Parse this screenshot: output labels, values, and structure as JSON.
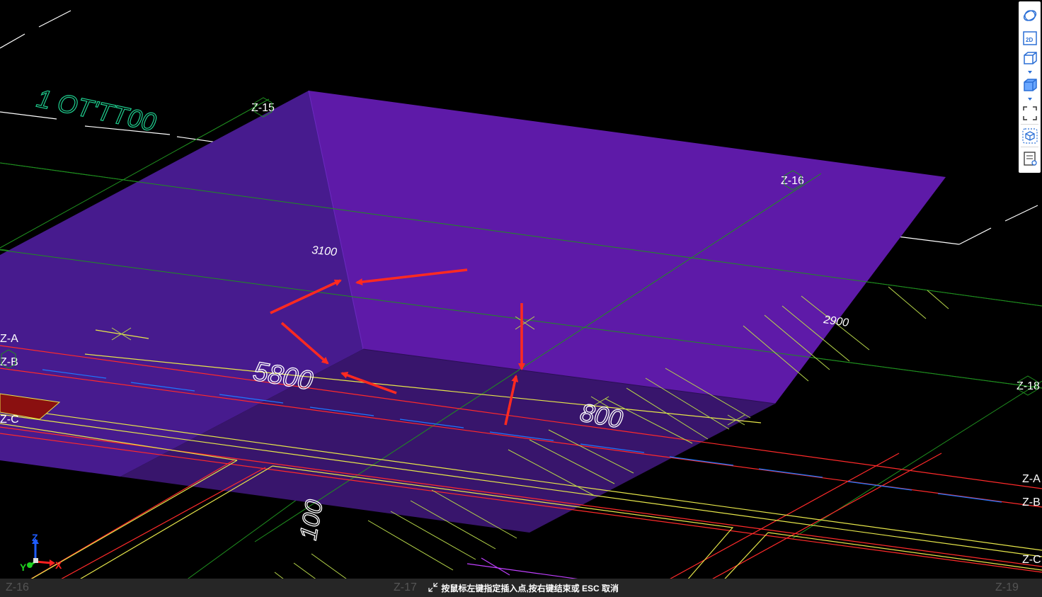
{
  "canvas": {
    "axis_labels": {
      "z15": "Z-15",
      "z16": "Z-16",
      "z18": "Z-18",
      "za_left": "Z-A",
      "zb_left": "Z-B",
      "zc_left": "Z-C",
      "za_right": "Z-A",
      "zb_right": "Z-B",
      "zc_right": "Z-C"
    },
    "dimensions": {
      "d3100": "3100",
      "d2900": "2900",
      "d5800": "5800",
      "d800": "800",
      "d100": "100",
      "d1100": "1 OT'TT00"
    },
    "gizmo": {
      "z": "Z",
      "y": "Y",
      "x": "X"
    },
    "colors": {
      "pit_top": "#5e1aa8",
      "pit_wall_left": "#471b8e",
      "pit_wall_front": "#3b1670",
      "grid_green": "#1f8f1f",
      "axis_red": "#ff2a2a",
      "arrow": "#ff2a20",
      "yellow_line": "#e6e64a",
      "blue_dash": "#1e78ff"
    }
  },
  "toolbar": {
    "icons": [
      "view-orbit-icon",
      "view-2d-icon",
      "view-3d-wire-icon",
      "view-3d-solid-icon",
      "fullscreen-icon",
      "iso-cube-icon",
      "properties-list-icon"
    ]
  },
  "statusbar": {
    "axis_left": "Z-16",
    "axis_mid": "Z-17",
    "axis_right": "Z-19",
    "message": "按鼠标左键指定插入点,按右键结束或 ESC 取消"
  }
}
